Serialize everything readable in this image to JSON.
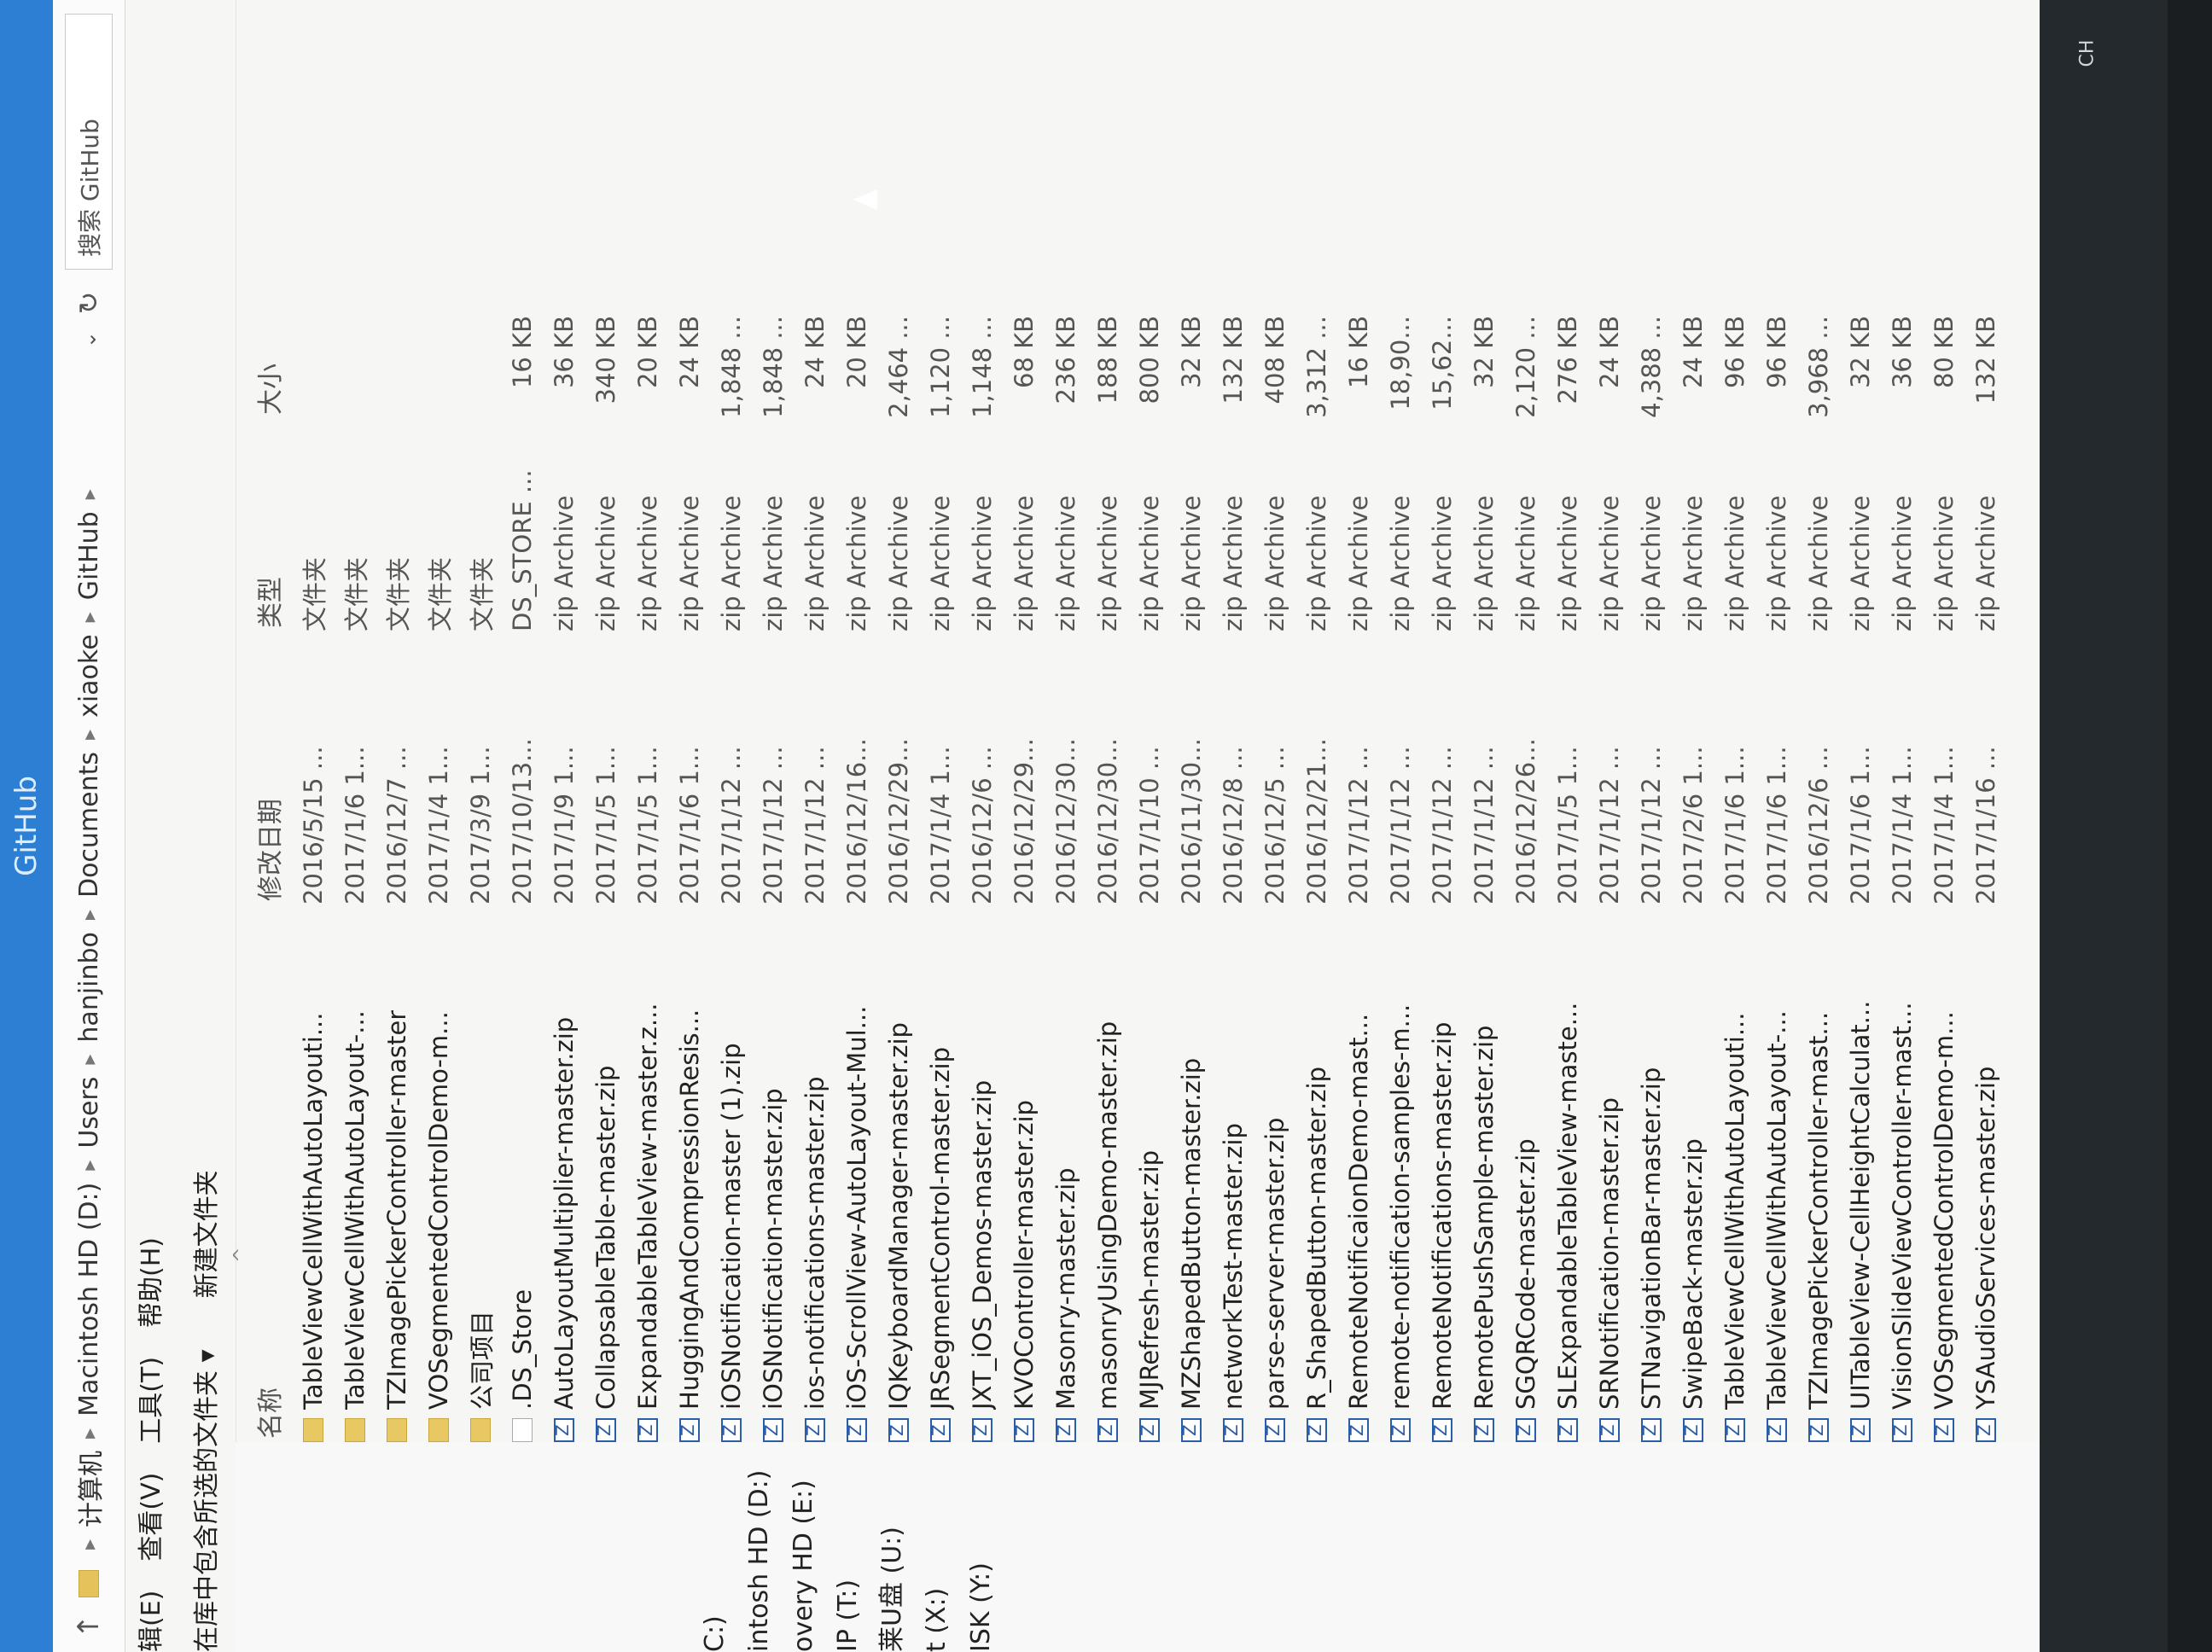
{
  "window": {
    "title": "GitHub"
  },
  "address": {
    "crumbs": [
      "计算机",
      "Macintosh HD (D:)",
      "Users",
      "hanjinbo",
      "Documents",
      "xiaoke",
      "GitHub"
    ],
    "search_placeholder": "搜索 GitHub"
  },
  "menu": [
    "辑(E)",
    "查看(V)",
    "工具(T)",
    "帮助(H)"
  ],
  "toolbar": {
    "include": "在库中包含所选的文件夹 ▾",
    "new_folder": "新建文件夹"
  },
  "sidebar": [
    "",
    "",
    "",
    "C:)",
    "intosh HD (D:)",
    "overy HD (E:)",
    "IP (T:)",
    "莱U盘 (U:)",
    "t (X:)",
    "ISK (Y:)"
  ],
  "columns": {
    "name": "名称",
    "date": "修改日期",
    "type": "类型",
    "size": "大小"
  },
  "files": [
    {
      "icon": "folder",
      "name": "TableViewCellWithAutoLayouti...",
      "date": "2016/5/15 ...",
      "type": "文件夹",
      "size": ""
    },
    {
      "icon": "folder",
      "name": "TableViewCellWithAutoLayout-...",
      "date": "2017/1/6 1...",
      "type": "文件夹",
      "size": ""
    },
    {
      "icon": "folder",
      "name": "TZImagePickerController-master",
      "date": "2016/12/7 ...",
      "type": "文件夹",
      "size": ""
    },
    {
      "icon": "folder",
      "name": "VOSegmentedControlDemo-m...",
      "date": "2017/1/4 1...",
      "type": "文件夹",
      "size": ""
    },
    {
      "icon": "folder",
      "name": "公司项目",
      "date": "2017/3/9 1...",
      "type": "文件夹",
      "size": ""
    },
    {
      "icon": "file",
      "name": ".DS_Store",
      "date": "2017/10/13...",
      "type": "DS_STORE ...",
      "size": "16 KB"
    },
    {
      "icon": "zip",
      "name": "AutoLayoutMultiplier-master.zip",
      "date": "2017/1/9 1...",
      "type": "zip Archive",
      "size": "36 KB"
    },
    {
      "icon": "zip",
      "name": "CollapsableTable-master.zip",
      "date": "2017/1/5 1...",
      "type": "zip Archive",
      "size": "340 KB"
    },
    {
      "icon": "zip",
      "name": "ExpandableTableView-master.z...",
      "date": "2017/1/5 1...",
      "type": "zip Archive",
      "size": "20 KB"
    },
    {
      "icon": "zip",
      "name": "HuggingAndCompressionResis...",
      "date": "2017/1/6 1...",
      "type": "zip Archive",
      "size": "24 KB"
    },
    {
      "icon": "zip",
      "name": "iOSNotification-master (1).zip",
      "date": "2017/1/12 ...",
      "type": "zip Archive",
      "size": "1,848 ..."
    },
    {
      "icon": "zip",
      "name": "iOSNotification-master.zip",
      "date": "2017/1/12 ...",
      "type": "zip Archive",
      "size": "1,848 ..."
    },
    {
      "icon": "zip",
      "name": "ios-notifications-master.zip",
      "date": "2017/1/12 ...",
      "type": "zip Archive",
      "size": "24 KB"
    },
    {
      "icon": "zip",
      "name": "iOS-ScrollView-AutoLayout-Mul...",
      "date": "2016/12/16...",
      "type": "zip Archive",
      "size": "20 KB"
    },
    {
      "icon": "zip",
      "name": "IQKeyboardManager-master.zip",
      "date": "2016/12/29...",
      "type": "zip Archive",
      "size": "2,464 ..."
    },
    {
      "icon": "zip",
      "name": "JRSegmentControl-master.zip",
      "date": "2017/1/4 1...",
      "type": "zip Archive",
      "size": "1,120 ..."
    },
    {
      "icon": "zip",
      "name": "JXT_iOS_Demos-master.zip",
      "date": "2016/12/6 ...",
      "type": "zip Archive",
      "size": "1,148 ..."
    },
    {
      "icon": "zip",
      "name": "KVOController-master.zip",
      "date": "2016/12/29...",
      "type": "zip Archive",
      "size": "68 KB"
    },
    {
      "icon": "zip",
      "name": "Masonry-master.zip",
      "date": "2016/12/30...",
      "type": "zip Archive",
      "size": "236 KB"
    },
    {
      "icon": "zip",
      "name": "masonryUsingDemo-master.zip",
      "date": "2016/12/30...",
      "type": "zip Archive",
      "size": "188 KB"
    },
    {
      "icon": "zip",
      "name": "MJRefresh-master.zip",
      "date": "2017/1/10 ...",
      "type": "zip Archive",
      "size": "800 KB"
    },
    {
      "icon": "zip",
      "name": "MZShapedButton-master.zip",
      "date": "2016/11/30...",
      "type": "zip Archive",
      "size": "32 KB"
    },
    {
      "icon": "zip",
      "name": "networkTest-master.zip",
      "date": "2016/12/8 ...",
      "type": "zip Archive",
      "size": "132 KB"
    },
    {
      "icon": "zip",
      "name": "parse-server-master.zip",
      "date": "2016/12/5 ...",
      "type": "zip Archive",
      "size": "408 KB"
    },
    {
      "icon": "zip",
      "name": "R_ShapedButton-master.zip",
      "date": "2016/12/21...",
      "type": "zip Archive",
      "size": "3,312 ..."
    },
    {
      "icon": "zip",
      "name": "RemoteNotificaionDemo-mast...",
      "date": "2017/1/12 ...",
      "type": "zip Archive",
      "size": "16 KB"
    },
    {
      "icon": "zip",
      "name": "remote-notification-samples-m...",
      "date": "2017/1/12 ...",
      "type": "zip Archive",
      "size": "18,90..."
    },
    {
      "icon": "zip",
      "name": "RemoteNotifications-master.zip",
      "date": "2017/1/12 ...",
      "type": "zip Archive",
      "size": "15,62..."
    },
    {
      "icon": "zip",
      "name": "RemotePushSample-master.zip",
      "date": "2017/1/12 ...",
      "type": "zip Archive",
      "size": "32 KB"
    },
    {
      "icon": "zip",
      "name": "SGQRCode-master.zip",
      "date": "2016/12/26...",
      "type": "zip Archive",
      "size": "2,120 ..."
    },
    {
      "icon": "zip",
      "name": "SLExpandableTableView-maste...",
      "date": "2017/1/5 1...",
      "type": "zip Archive",
      "size": "276 KB"
    },
    {
      "icon": "zip",
      "name": "SRNotification-master.zip",
      "date": "2017/1/12 ...",
      "type": "zip Archive",
      "size": "24 KB"
    },
    {
      "icon": "zip",
      "name": "STNavigationBar-master.zip",
      "date": "2017/1/12 ...",
      "type": "zip Archive",
      "size": "4,388 ..."
    },
    {
      "icon": "zip",
      "name": "SwipeBack-master.zip",
      "date": "2017/2/6 1...",
      "type": "zip Archive",
      "size": "24 KB"
    },
    {
      "icon": "zip",
      "name": "TableViewCellWithAutoLayouti...",
      "date": "2017/1/6 1...",
      "type": "zip Archive",
      "size": "96 KB"
    },
    {
      "icon": "zip",
      "name": "TableViewCellWithAutoLayout-...",
      "date": "2017/1/6 1...",
      "type": "zip Archive",
      "size": "96 KB"
    },
    {
      "icon": "zip",
      "name": "TZImagePickerController-mast...",
      "date": "2016/12/6 ...",
      "type": "zip Archive",
      "size": "3,968 ..."
    },
    {
      "icon": "zip",
      "name": "UITableView-CellHeightCalculat...",
      "date": "2017/1/6 1...",
      "type": "zip Archive",
      "size": "32 KB"
    },
    {
      "icon": "zip",
      "name": "VisionSlideViewController-mast...",
      "date": "2017/1/4 1...",
      "type": "zip Archive",
      "size": "36 KB"
    },
    {
      "icon": "zip",
      "name": "VOSegmentedControlDemo-m...",
      "date": "2017/1/4 1...",
      "type": "zip Archive",
      "size": "80 KB"
    },
    {
      "icon": "zip",
      "name": "YSAudioServices-master.zip",
      "date": "2017/1/16 ...",
      "type": "zip Archive",
      "size": "132 KB"
    }
  ],
  "tray": {
    "lang": "CH"
  },
  "colors": {
    "titlebar": "#2d7fd3",
    "zip_icon": "#2a5ea8",
    "folder_icon": "#e8c862"
  }
}
